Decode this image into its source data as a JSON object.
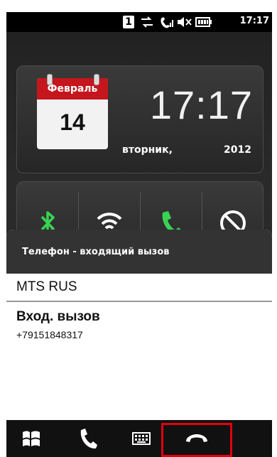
{
  "status_bar": {
    "sim_number": "1",
    "time": "17:17",
    "icons": [
      "sim-card-icon",
      "data-transfer-icon",
      "signal-icon",
      "mute-icon",
      "battery-icon"
    ]
  },
  "clock_widget": {
    "month": "Февраль",
    "day": "14",
    "time": "17:17",
    "weekday": "вторник,",
    "year": "2012"
  },
  "toggles": [
    "bluetooth-icon",
    "wifi-icon",
    "phone-icon",
    "block-icon"
  ],
  "dialog": {
    "title": "Телефон - входящий вызов",
    "operator": "MTS RUS",
    "call_type": "Вход. вызов",
    "number": "+79151848317"
  },
  "bottom_bar": [
    "start-icon",
    "phone-icon",
    "keyboard-icon",
    "end-call-icon"
  ],
  "colors": {
    "accent_green": "#39d353",
    "calendar_red": "#c4161c",
    "highlight_red": "#e3000f"
  }
}
